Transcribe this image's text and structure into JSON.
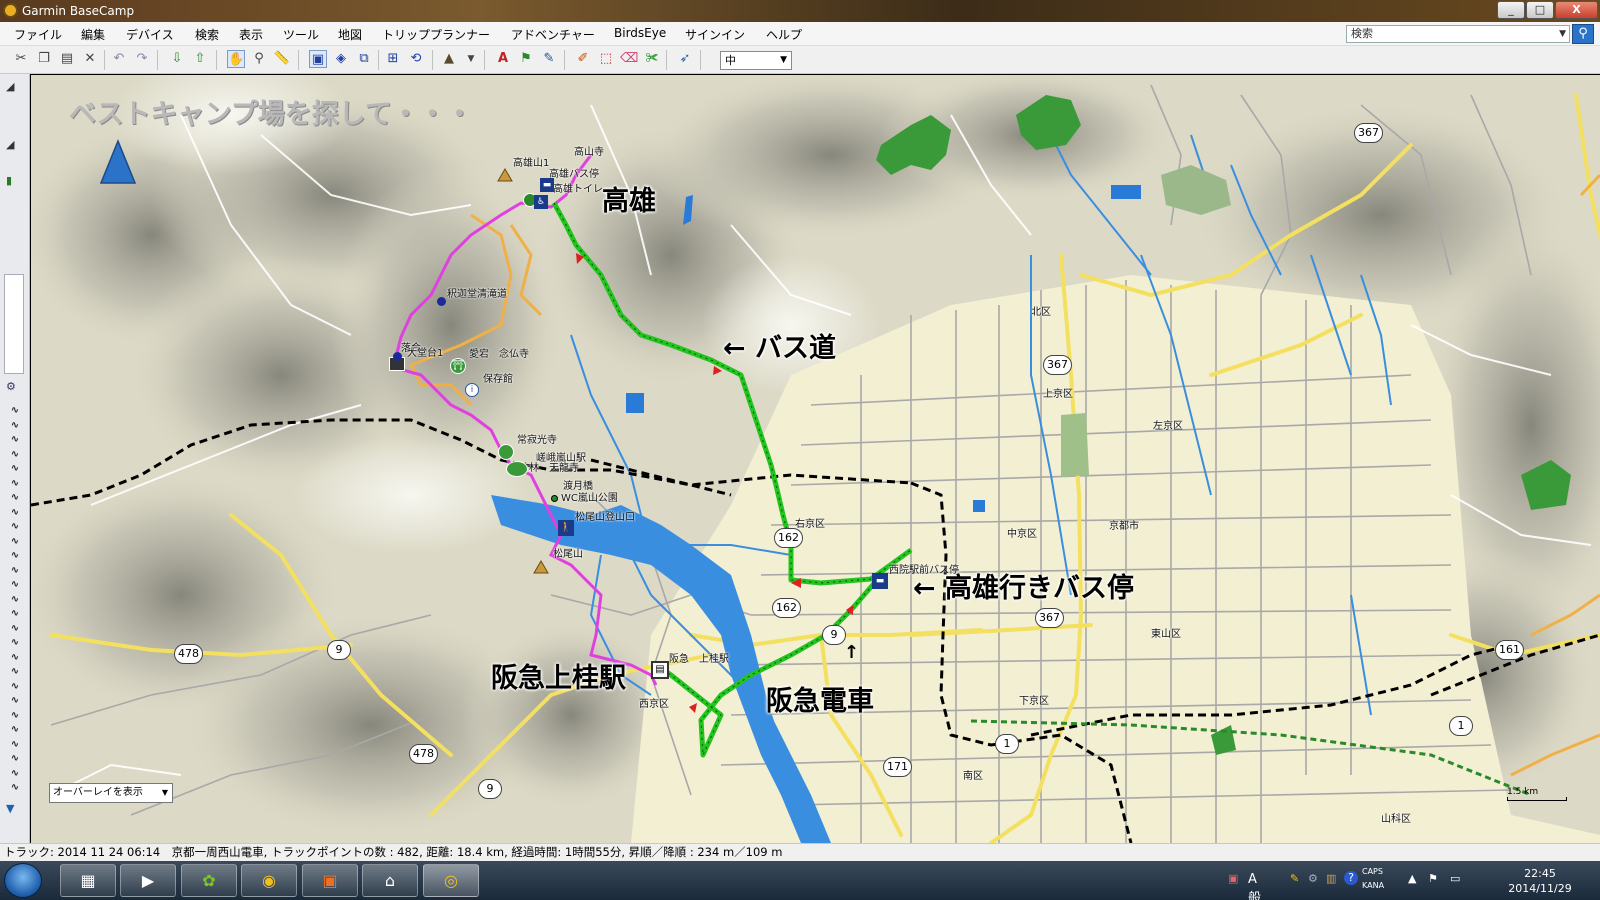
{
  "window": {
    "title": "Garmin BaseCamp",
    "min": "_",
    "max": "□",
    "close": "X"
  },
  "menu": [
    "ファイル",
    "編集",
    "デバイス",
    "検索",
    "表示",
    "ツール",
    "地図",
    "トリッププランナー",
    "アドベンチャー",
    "BirdsEye",
    "サインイン",
    "ヘルプ"
  ],
  "search": {
    "placeholder": "検索",
    "icon": "search-icon"
  },
  "toolbar": {
    "zoom_value": "中"
  },
  "sidebar": {
    "filter_icon": "filter-icon",
    "settings_icon": "gear-icon"
  },
  "map": {
    "title": "ベストキャンプ場を探して・・・",
    "annotations": {
      "takao": "高雄",
      "bus_road": "← バス道",
      "takao_bus_stop": "← 高雄行きバス停",
      "kamikatsura": "阪急上桂駅",
      "hankyu": "阪急電車"
    },
    "poi": {
      "takasan_ji": "高山寺",
      "takaoyama1": "高雄山1",
      "takao_bus": "高雄バス停",
      "takao_toilet": "高雄トイレ",
      "shakado": "釈迦堂清滝道",
      "ochiai": "落合",
      "ochiai_dai": "大堂台1",
      "atago_nenbutsu": "愛宕　念仏寺",
      "hozonkan": "保存館",
      "jojakko": "常寂光寺",
      "saga_station": "嵯峨嵐山駅",
      "tenryuji": "竹林　天龍寺",
      "togetsukyo": "渡月橋",
      "wc_arashiyama": "WC嵐山公園",
      "matsuo_trail": "松尾山登山口",
      "matsuo_yama": "松尾山",
      "saiin_bus": "西院駅前バス停",
      "kamikatsura_station": "阪急　上桂駅"
    },
    "wards": [
      "北区",
      "上京区",
      "左京区",
      "中京区",
      "京都市",
      "右京区",
      "東山区",
      "西京区",
      "下京区",
      "南区",
      "山科区"
    ],
    "routes": [
      "367",
      "367",
      "367",
      "162",
      "162",
      "9",
      "9",
      "9",
      "478",
      "478",
      "171",
      "1",
      "1",
      "161"
    ],
    "overlay_select": "オーバーレイを表示",
    "scale": "1.5 km"
  },
  "status": "トラック: 2014 11 24 06:14　京都一周西山電車, トラックポイントの数 : 482, 距離: 18.4 km, 経過時間: 1時間55分, 昇順／降順 : 234 m／109 m",
  "taskbar": {
    "ime": "A 般",
    "caps": "CAPS",
    "kana": "KANA",
    "time": "22:45",
    "date": "2014/11/29"
  },
  "colors": {
    "track": "#22c41e",
    "trail": "#e040e0",
    "accent": "#2b73c8"
  }
}
